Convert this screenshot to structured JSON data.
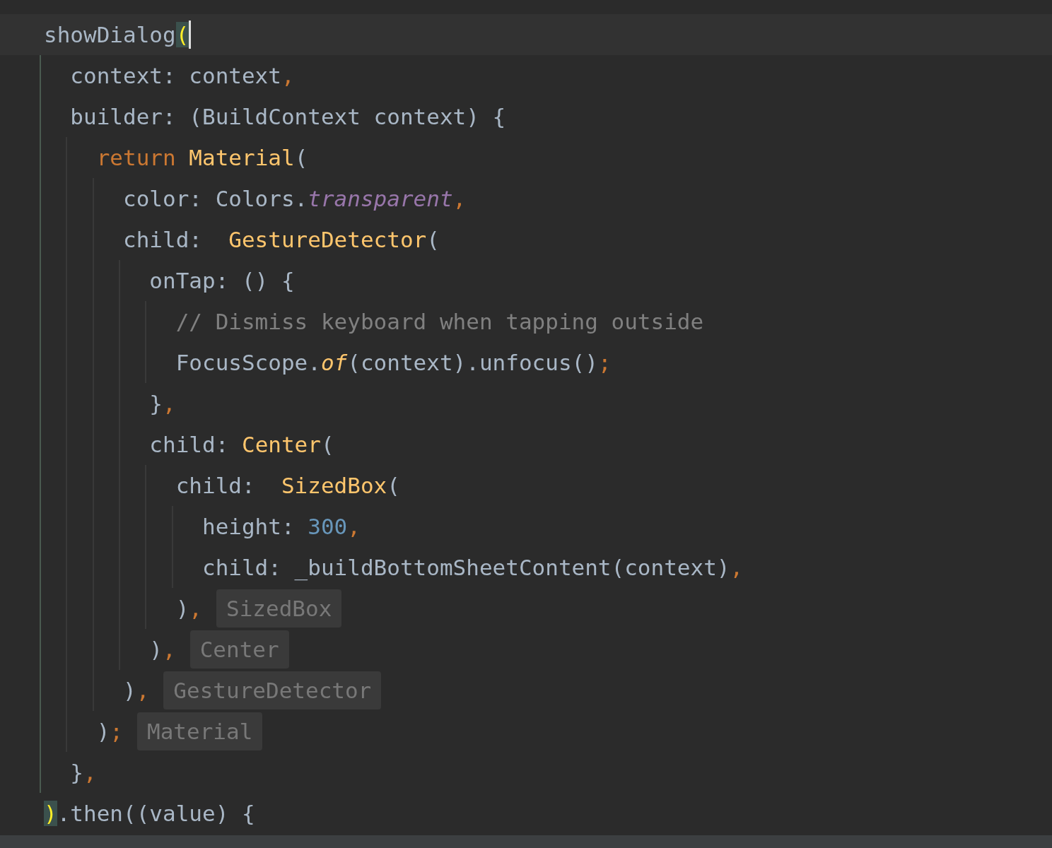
{
  "editor": {
    "lines": [
      {
        "current": true,
        "tokens": [
          {
            "text": "showDialog",
            "kind": "plain"
          },
          {
            "text": "(",
            "kind": "match"
          }
        ]
      },
      {
        "current": false,
        "tokens": [
          {
            "text": "  context: context",
            "kind": "plain"
          },
          {
            "text": ",",
            "kind": "punct"
          }
        ]
      },
      {
        "current": false,
        "tokens": [
          {
            "text": "  builder: (BuildContext context) {",
            "kind": "plain"
          }
        ]
      },
      {
        "current": false,
        "tokens": [
          {
            "text": "    return ",
            "kind": "keyword"
          },
          {
            "text": "Material",
            "kind": "call"
          },
          {
            "text": "(",
            "kind": "plain"
          }
        ]
      },
      {
        "current": false,
        "tokens": [
          {
            "text": "      color: Colors.",
            "kind": "plain"
          },
          {
            "text": "transparent",
            "kind": "field"
          },
          {
            "text": ",",
            "kind": "punct"
          }
        ]
      },
      {
        "current": false,
        "tokens": [
          {
            "text": "      child:  ",
            "kind": "plain"
          },
          {
            "text": "GestureDetector",
            "kind": "call"
          },
          {
            "text": "(",
            "kind": "plain"
          }
        ]
      },
      {
        "current": false,
        "tokens": [
          {
            "text": "        onTap: () {",
            "kind": "plain"
          }
        ]
      },
      {
        "current": false,
        "tokens": [
          {
            "text": "          // Dismiss keyboard when tapping outside",
            "kind": "comment"
          }
        ]
      },
      {
        "current": false,
        "tokens": [
          {
            "text": "          FocusScope.",
            "kind": "plain"
          },
          {
            "text": "of",
            "kind": "static"
          },
          {
            "text": "(context).unfocus()",
            "kind": "plain"
          },
          {
            "text": ";",
            "kind": "punct"
          }
        ]
      },
      {
        "current": false,
        "tokens": [
          {
            "text": "        }",
            "kind": "plain"
          },
          {
            "text": ",",
            "kind": "punct"
          }
        ]
      },
      {
        "current": false,
        "tokens": [
          {
            "text": "        child: ",
            "kind": "plain"
          },
          {
            "text": "Center",
            "kind": "call"
          },
          {
            "text": "(",
            "kind": "plain"
          }
        ]
      },
      {
        "current": false,
        "tokens": [
          {
            "text": "          child:  ",
            "kind": "plain"
          },
          {
            "text": "SizedBox",
            "kind": "call"
          },
          {
            "text": "(",
            "kind": "plain"
          }
        ]
      },
      {
        "current": false,
        "tokens": [
          {
            "text": "            height: ",
            "kind": "plain"
          },
          {
            "text": "300",
            "kind": "number"
          },
          {
            "text": ",",
            "kind": "punct"
          }
        ]
      },
      {
        "current": false,
        "tokens": [
          {
            "text": "            child: _buildBottomSheetContent(context)",
            "kind": "plain"
          },
          {
            "text": ",",
            "kind": "punct"
          }
        ]
      },
      {
        "current": false,
        "tokens": [
          {
            "text": "          )",
            "kind": "plain"
          },
          {
            "text": ",",
            "kind": "punct"
          }
        ],
        "hint": "SizedBox"
      },
      {
        "current": false,
        "tokens": [
          {
            "text": "        )",
            "kind": "plain"
          },
          {
            "text": ",",
            "kind": "punct"
          }
        ],
        "hint": "Center"
      },
      {
        "current": false,
        "tokens": [
          {
            "text": "      )",
            "kind": "plain"
          },
          {
            "text": ",",
            "kind": "punct"
          }
        ],
        "hint": "GestureDetector"
      },
      {
        "current": false,
        "tokens": [
          {
            "text": "    )",
            "kind": "plain"
          },
          {
            "text": ";",
            "kind": "punct"
          }
        ],
        "hint": "Material"
      },
      {
        "current": false,
        "tokens": [
          {
            "text": "  }",
            "kind": "plain"
          },
          {
            "text": ",",
            "kind": "punct"
          }
        ]
      },
      {
        "current": false,
        "tokens": [
          {
            "text": ")",
            "kind": "match"
          },
          {
            "text": ".then((value) {",
            "kind": "plain"
          }
        ]
      }
    ]
  }
}
